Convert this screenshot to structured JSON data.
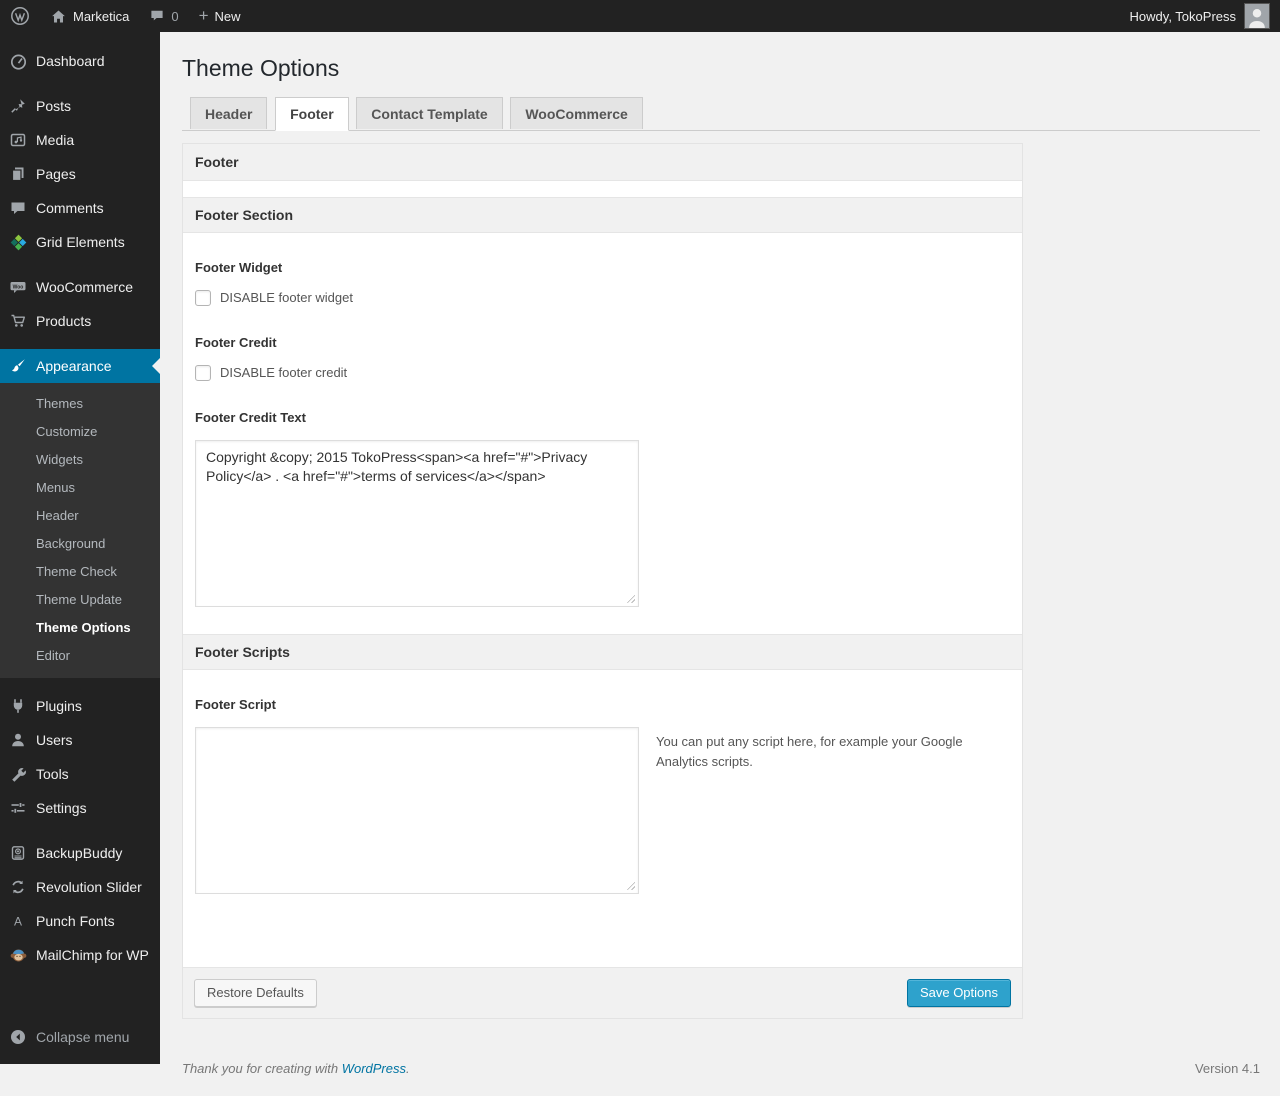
{
  "colors": {
    "accent": "#0074a2",
    "button_primary": "#2ea2cc",
    "admin_bar_bg": "#222222",
    "content_bg": "#f1f1f1"
  },
  "admin_bar": {
    "site_name": "Marketica",
    "comment_count": "0",
    "new_label": "New",
    "howdy_text": "Howdy, TokoPress"
  },
  "sidebar": {
    "items": [
      {
        "label": "Dashboard",
        "icon": "dashboard-icon"
      },
      {
        "label": "Posts",
        "icon": "pin-icon"
      },
      {
        "label": "Media",
        "icon": "media-icon"
      },
      {
        "label": "Pages",
        "icon": "pages-icon"
      },
      {
        "label": "Comments",
        "icon": "comments-icon"
      },
      {
        "label": "Grid Elements",
        "icon": "grid-elements-icon"
      },
      {
        "label": "WooCommerce",
        "icon": "woocommerce-icon"
      },
      {
        "label": "Products",
        "icon": "cart-icon"
      },
      {
        "label": "Appearance",
        "icon": "appearance-icon",
        "active": true
      },
      {
        "label": "Plugins",
        "icon": "plugin-icon"
      },
      {
        "label": "Users",
        "icon": "user-icon"
      },
      {
        "label": "Tools",
        "icon": "wrench-icon"
      },
      {
        "label": "Settings",
        "icon": "settings-icon"
      },
      {
        "label": "BackupBuddy",
        "icon": "backup-icon"
      },
      {
        "label": "Revolution Slider",
        "icon": "revolution-icon"
      },
      {
        "label": "Punch Fonts",
        "icon": "letter-a-icon"
      },
      {
        "label": "MailChimp for WP",
        "icon": "mailchimp-icon"
      }
    ],
    "submenu": {
      "items": [
        "Themes",
        "Customize",
        "Widgets",
        "Menus",
        "Header",
        "Background",
        "Theme Check",
        "Theme Update",
        "Theme Options",
        "Editor"
      ],
      "current": "Theme Options"
    },
    "collapse_label": "Collapse menu"
  },
  "main": {
    "page_title": "Theme Options",
    "tabs": [
      {
        "label": "Header"
      },
      {
        "label": "Footer",
        "active": true
      },
      {
        "label": "Contact Template"
      },
      {
        "label": "WooCommerce"
      }
    ],
    "panel": {
      "header_title": "Footer",
      "footer_section_title": "Footer Section",
      "footer_widget_label": "Footer Widget",
      "footer_widget_checkbox": "DISABLE footer widget",
      "footer_widget_checked": false,
      "footer_credit_label": "Footer Credit",
      "footer_credit_checkbox": "DISABLE footer credit",
      "footer_credit_checked": false,
      "footer_credit_text_label": "Footer Credit Text",
      "footer_credit_text_value": "Copyright &copy; 2015 TokoPress<span><a href=\"#\">Privacy Policy</a> . <a href=\"#\">terms of services</a></span>",
      "footer_scripts_title": "Footer Scripts",
      "footer_script_label": "Footer Script",
      "footer_script_value": "",
      "footer_script_help": "You can put any script here, for example your Google Analytics scripts.",
      "restore_button": "Restore Defaults",
      "save_button": "Save Options"
    }
  },
  "page_footer": {
    "thanks_prefix": "Thank you for creating with ",
    "wordpress_link": "WordPress",
    "thanks_suffix": ".",
    "version": "Version 4.1"
  }
}
